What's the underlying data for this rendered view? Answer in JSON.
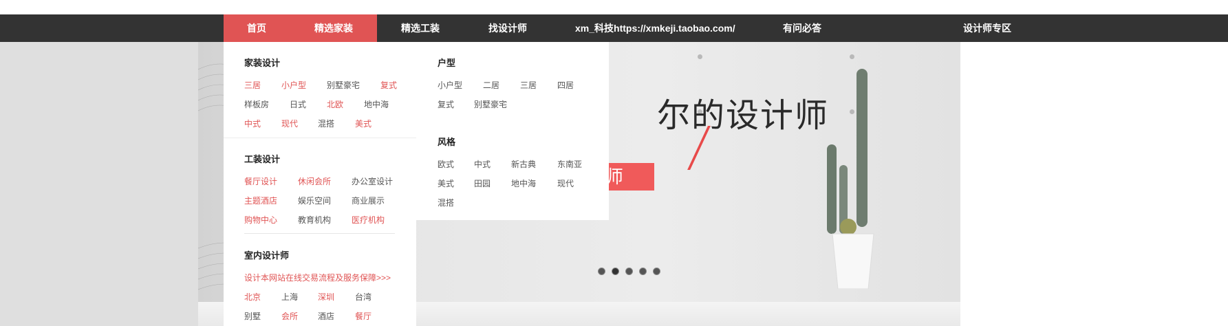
{
  "nav": {
    "items": [
      "首页",
      "精选家装",
      "精选工装",
      "找设计师",
      "xm_科技https://xmkeji.taobao.com/",
      "有问必答",
      "设计师专区"
    ]
  },
  "menu": {
    "home_decor": {
      "title": "家装设计",
      "rows": [
        [
          "三居",
          "小户型",
          "别墅豪宅",
          "复式"
        ],
        [
          "样板房",
          "日式",
          "北欧",
          "地中海"
        ],
        [
          "中式",
          "现代",
          "混搭",
          "美式"
        ]
      ]
    },
    "commercial": {
      "title": "工装设计",
      "rows": [
        [
          "餐厅设计",
          "休闲会所",
          "办公室设计"
        ],
        [
          "主题酒店",
          "娱乐空间",
          "商业展示"
        ],
        [
          "购物中心",
          "教育机构",
          "医疗机构"
        ]
      ]
    },
    "interior": {
      "title": "室内设计师",
      "notice": "设计本网站在线交易流程及服务保障>>>",
      "rows": [
        [
          "北京",
          "上海",
          "深圳",
          "台湾"
        ],
        [
          "别墅",
          "会所",
          "酒店",
          "餐厅"
        ]
      ]
    },
    "layout_type": {
      "title": "户型",
      "rows": [
        [
          "小户型",
          "二居",
          "三居",
          "四居"
        ],
        [
          "复式",
          "别墅豪宅"
        ]
      ]
    },
    "style": {
      "title": "风格",
      "rows": [
        [
          "欧式",
          "中式",
          "新古典",
          "东南亚"
        ],
        [
          "美式",
          "田园",
          "地中海",
          "现代"
        ],
        [
          "混搭"
        ]
      ]
    }
  },
  "banner": {
    "slogan": "尔的设计师",
    "sub": "10秒智能匹配设计师",
    "dots": 5,
    "active_dot": 1
  },
  "colors": {
    "accent": "#e05454",
    "nav_bg": "#333333"
  }
}
